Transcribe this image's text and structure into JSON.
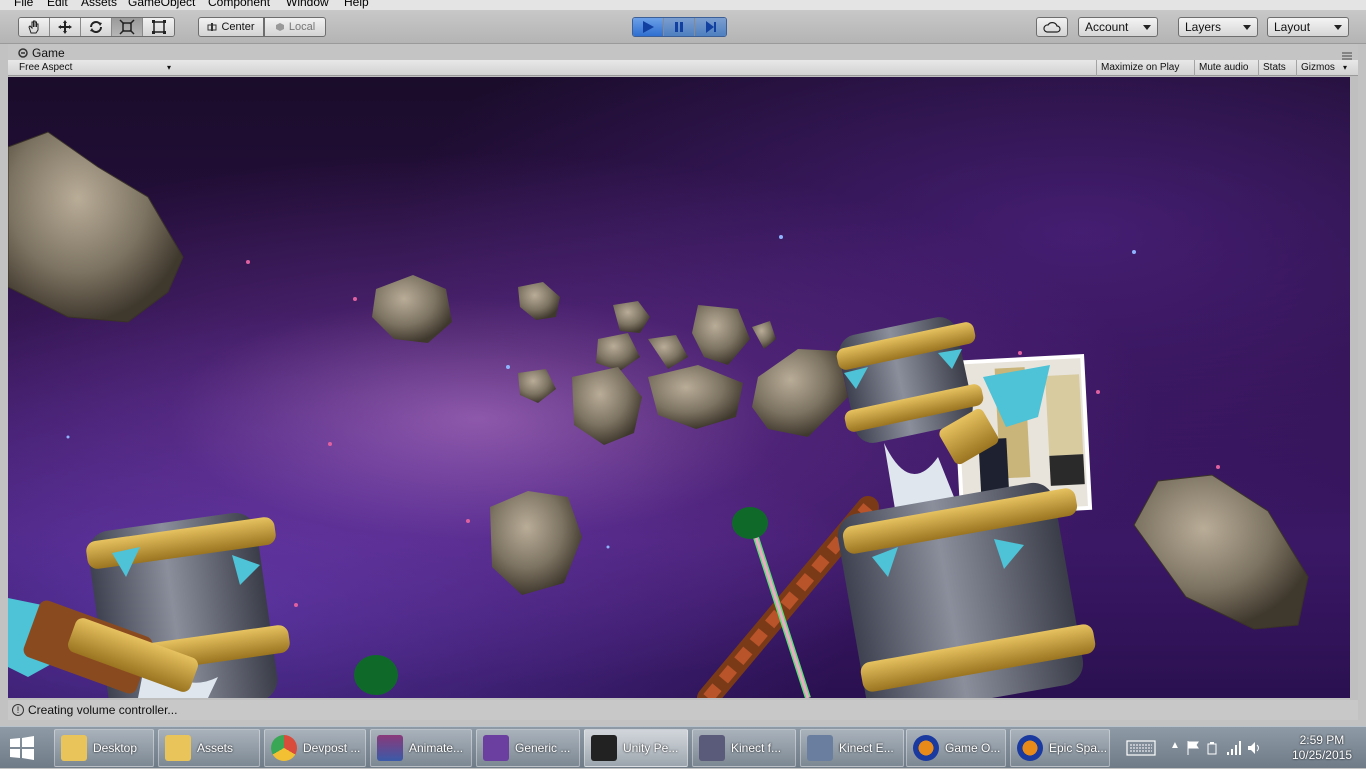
{
  "menu": [
    "File",
    "Edit",
    "Assets",
    "GameObject",
    "Component",
    "Window",
    "Help"
  ],
  "toolbar": {
    "tools": [
      "hand-icon",
      "move-icon",
      "rotate-icon",
      "scale-icon",
      "rect-icon"
    ],
    "pivot_label": "Center",
    "space_label": "Local",
    "account_label": "Account",
    "layers_label": "Layers",
    "layout_label": "Layout"
  },
  "game_panel": {
    "tab_label": "Game",
    "aspect_label": "Free Aspect",
    "maximize_label": "Maximize on Play",
    "mute_label": "Mute audio",
    "stats_label": "Stats",
    "gizmos_label": "Gizmos"
  },
  "status": {
    "message": "Creating volume controller..."
  },
  "taskbar": {
    "items": [
      {
        "label": "Desktop",
        "icon": "folder-icon",
        "color": "#e8c45a"
      },
      {
        "label": "Assets",
        "icon": "folder-icon",
        "color": "#e8c45a"
      },
      {
        "label": "Devpost ...",
        "icon": "chrome-icon",
        "color": "#d94b3b"
      },
      {
        "label": "Animate...",
        "icon": "winrar-icon",
        "color": "#8a3a7a"
      },
      {
        "label": "Generic ...",
        "icon": "visual-studio-icon",
        "color": "#6b3fa0"
      },
      {
        "label": "Unity Pe...",
        "icon": "unity-icon",
        "color": "#222222"
      },
      {
        "label": "Kinect f...",
        "icon": "kinect-icon",
        "color": "#5a5a7a"
      },
      {
        "label": "Kinect E...",
        "icon": "kinect-icon",
        "color": "#6a7fa0"
      },
      {
        "label": "Game O...",
        "icon": "audacity-icon",
        "color": "#e88a1a"
      },
      {
        "label": "Epic Spa...",
        "icon": "audacity-icon",
        "color": "#e88a1a"
      }
    ],
    "time": "2:59 PM",
    "date": "10/25/2015"
  },
  "colors": {
    "play_blue": "#2f6fd0",
    "space_purple": "#3b1866"
  }
}
